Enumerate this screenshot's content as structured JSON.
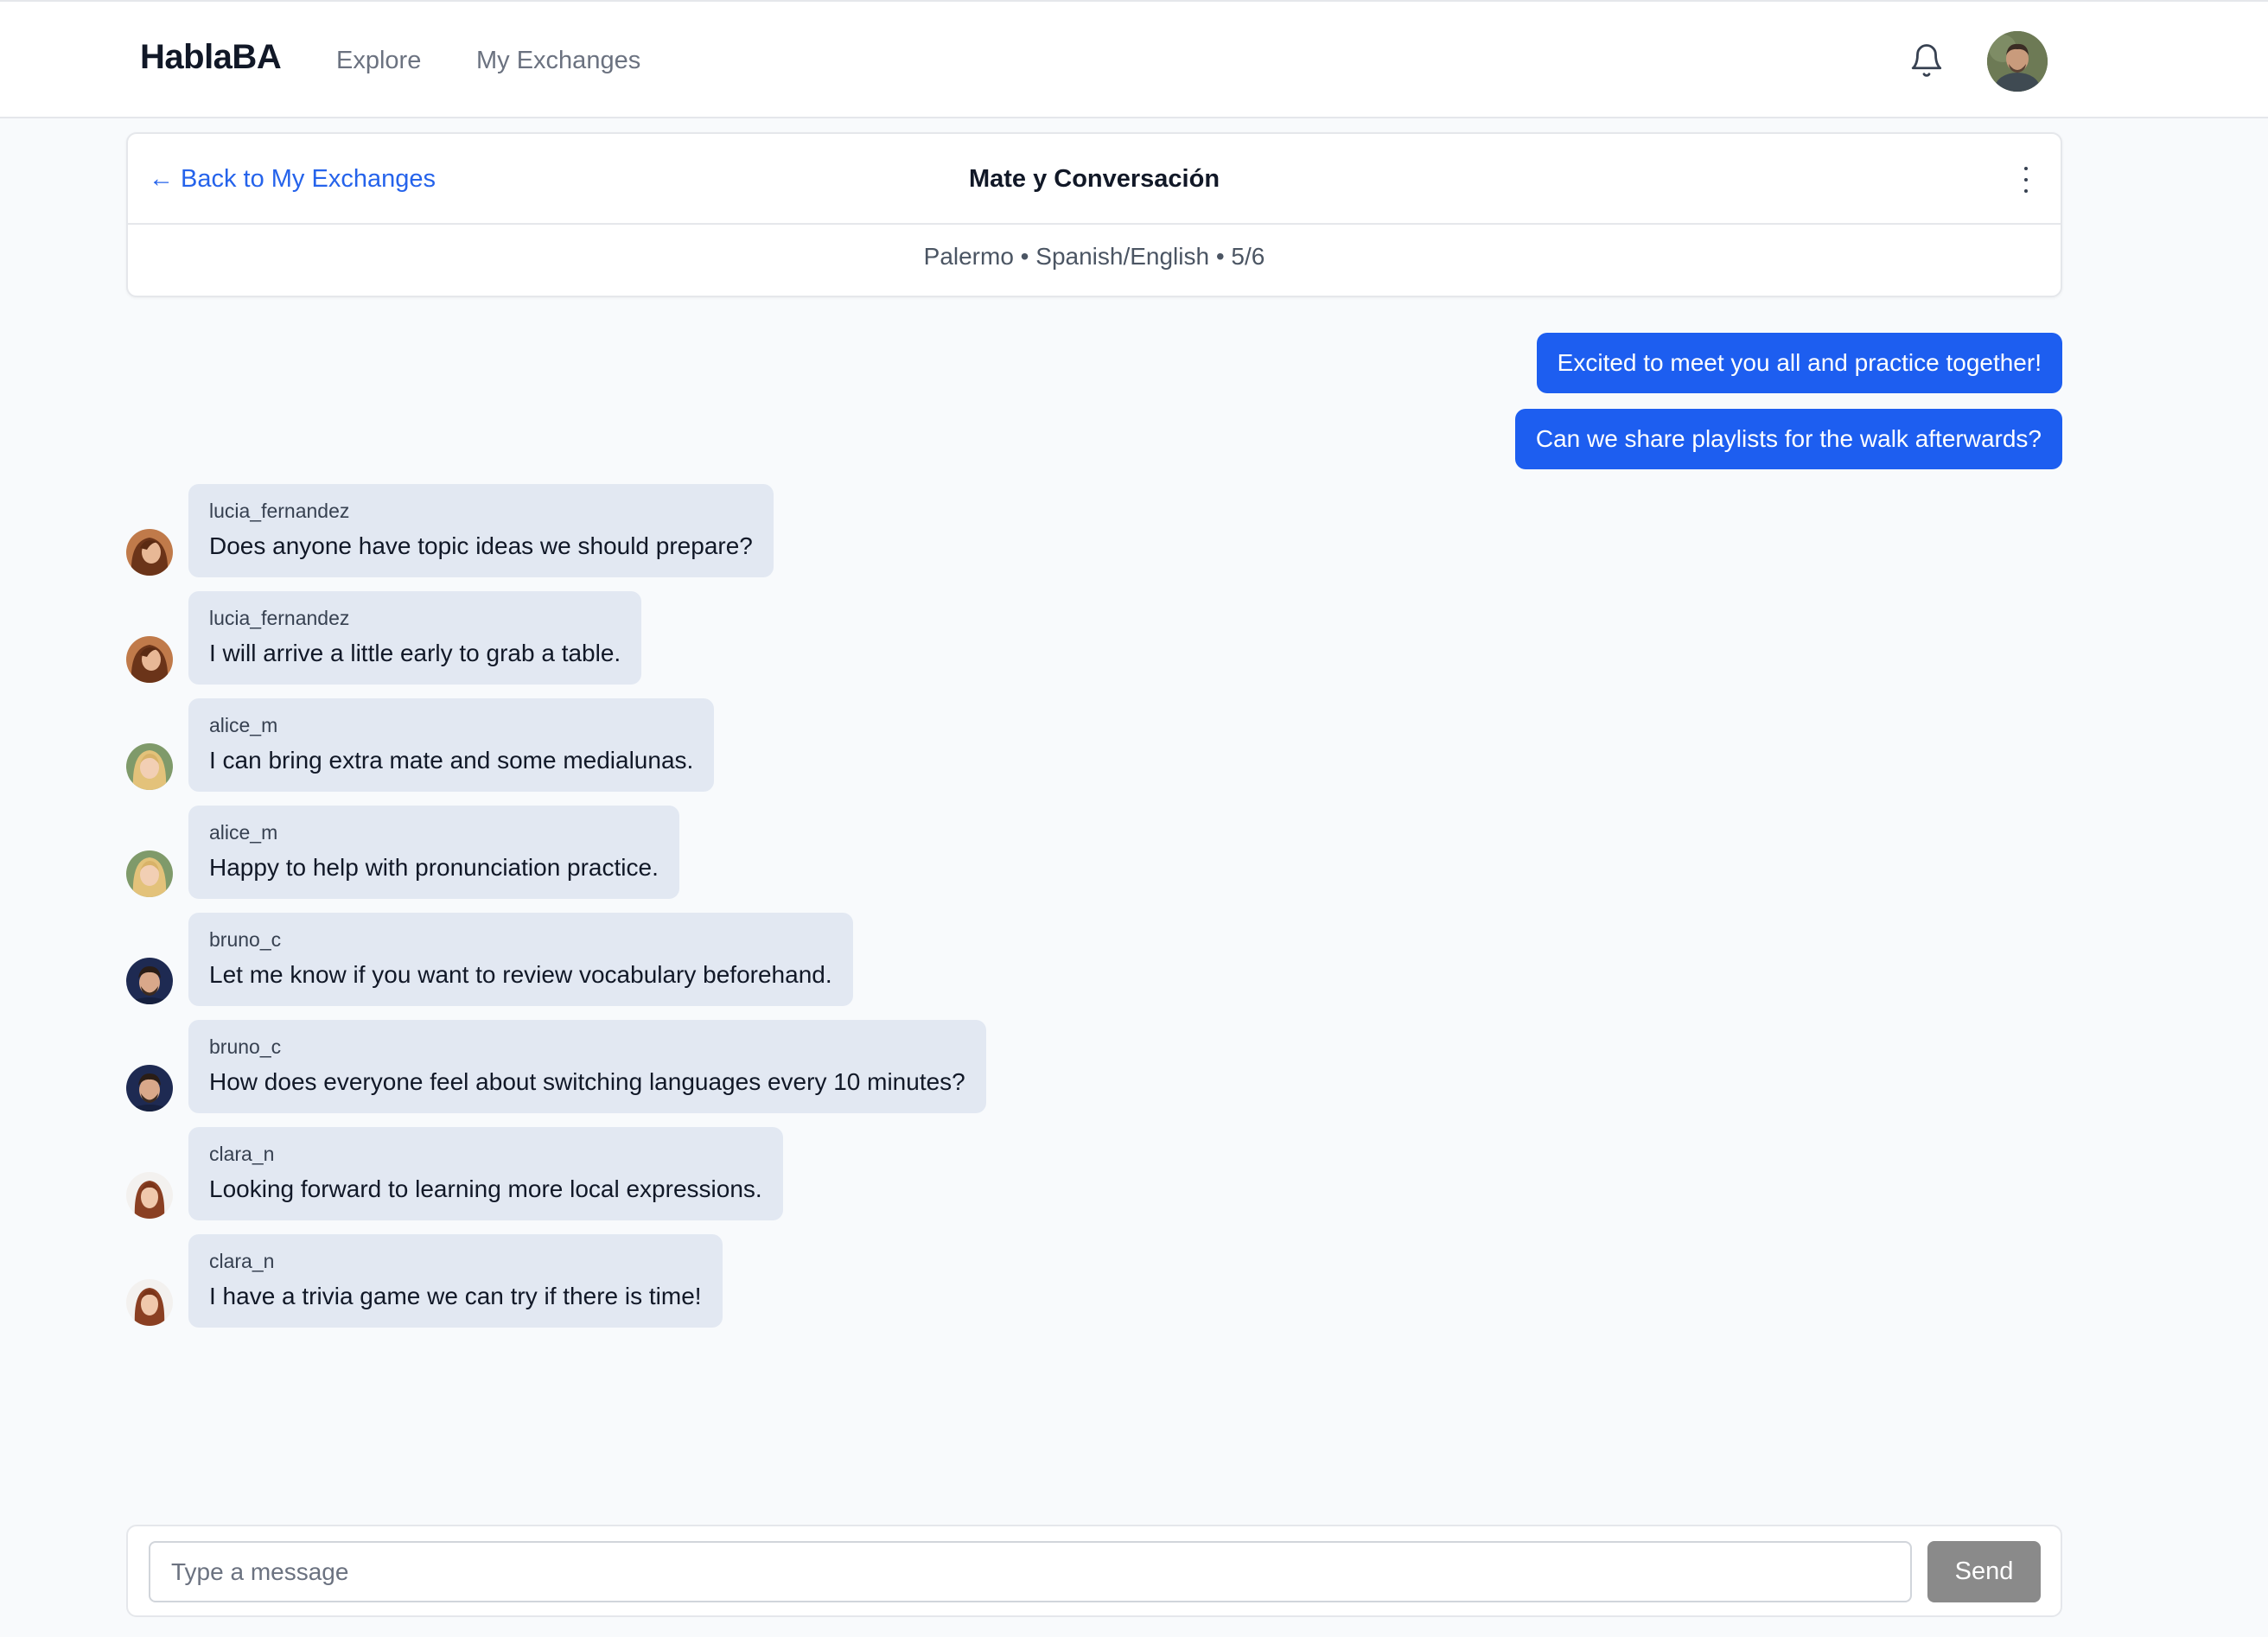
{
  "app": {
    "brand": "HablaBA"
  },
  "nav": {
    "explore": "Explore",
    "my_exchanges": "My Exchanges"
  },
  "icons": {
    "notifications": "bell-icon",
    "more": "more-vertical-icon",
    "back": "arrow-left-icon"
  },
  "exchange": {
    "back_label": "Back to My Exchanges",
    "back_arrow": "←",
    "title": "Mate y Conversación",
    "meta": "Palermo • Spanish/English • 5/6"
  },
  "outgoing": [
    {
      "text": "Excited to meet you all and practice together!"
    },
    {
      "text": "Can we share playlists for the walk afterwards?"
    }
  ],
  "messages": [
    {
      "sender": "lucia_fernandez",
      "text": "Does anyone have topic ideas we should prepare?"
    },
    {
      "sender": "lucia_fernandez",
      "text": "I will arrive a little early to grab a table."
    },
    {
      "sender": "alice_m",
      "text": "I can bring extra mate and some medialunas."
    },
    {
      "sender": "alice_m",
      "text": "Happy to help with pronunciation practice."
    },
    {
      "sender": "bruno_c",
      "text": "Let me know if you want to review vocabulary beforehand."
    },
    {
      "sender": "bruno_c",
      "text": "How does everyone feel about switching languages every 10 minutes?"
    },
    {
      "sender": "clara_n",
      "text": "Looking forward to learning more local expressions."
    },
    {
      "sender": "clara_n",
      "text": "I have a trivia game we can try if there is time!"
    }
  ],
  "composer": {
    "placeholder": "Type a message",
    "value": "",
    "send_label": "Send"
  },
  "colors": {
    "accent": "#1d5ef0",
    "link": "#2563eb",
    "bubble_incoming": "#e2e8f2",
    "send_disabled": "#8a8a8a",
    "background": "#f8fafc"
  }
}
